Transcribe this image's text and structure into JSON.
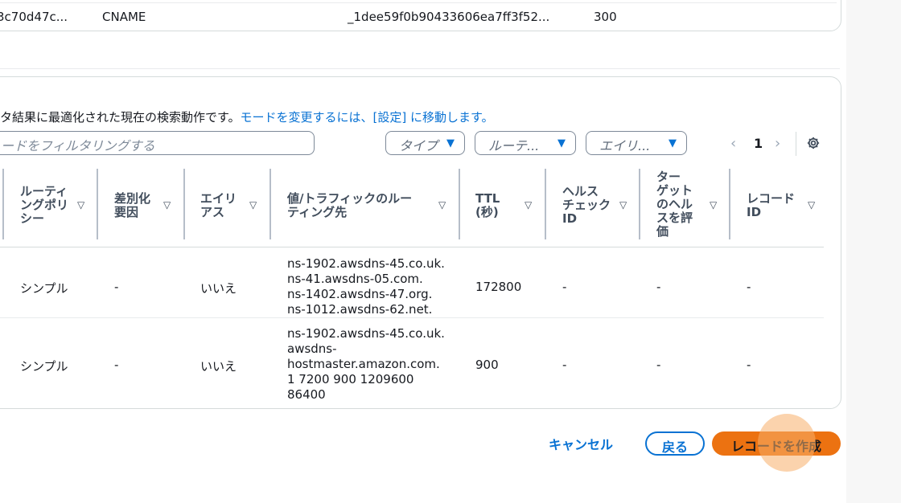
{
  "top_row": {
    "record_name": "3c70d47c...",
    "type": "CNAME",
    "value": "_1dee59f0b90433606ea7ff3f52...",
    "ttl": "300"
  },
  "info": {
    "prefix": "タ結果に最適化された現在の検索動作です。",
    "link": "モードを変更するには、[設定] に移動します。"
  },
  "search": {
    "placeholder": "ードをフィルタリングする"
  },
  "filters": [
    {
      "label": "タイプ"
    },
    {
      "label": "ルーテ..."
    },
    {
      "label": "エイリ..."
    }
  ],
  "pagination": {
    "current_page": "1"
  },
  "columns": [
    {
      "label": "ルーティ\nングポリ\nシー"
    },
    {
      "label": "差別化\n要因"
    },
    {
      "label": "エイリ\nアス"
    },
    {
      "label": "値/トラフィックのルー\nティング先"
    },
    {
      "label": "TTL\n(秒)"
    },
    {
      "label": "ヘルス\nチェック\nID"
    },
    {
      "label": "ター\nゲット\nのヘル\nスを評\n価"
    },
    {
      "label": "レコード\nID"
    }
  ],
  "rows": [
    {
      "routing_policy": "シンプル",
      "differentiator": "-",
      "alias": "いいえ",
      "value": [
        "ns-1902.awsdns-45.co.uk.",
        "ns-41.awsdns-05.com.",
        "ns-1402.awsdns-47.org.",
        "ns-1012.awsdns-62.net."
      ],
      "ttl": "172800",
      "health_check_id": "-",
      "evaluate_health": "-",
      "record_id": "-"
    },
    {
      "routing_policy": "シンプル",
      "differentiator": "-",
      "alias": "いいえ",
      "value": [
        "ns-1902.awsdns-45.co.uk.",
        "awsdns-",
        "hostmaster.amazon.com.",
        "1 7200 900 1209600",
        "86400"
      ],
      "ttl": "900",
      "health_check_id": "-",
      "evaluate_health": "-",
      "record_id": "-"
    }
  ],
  "footer": {
    "cancel": "キャンセル",
    "back": "戻る",
    "create": "レコードを作成"
  },
  "colors": {
    "link": "#0972d3",
    "primary_button": "#ec7211",
    "border": "#d5dbdb"
  },
  "icons": {
    "filter_caret": "caret-down-icon",
    "prev": "chevron-left-icon",
    "next": "chevron-right-icon",
    "settings": "gear-icon"
  }
}
